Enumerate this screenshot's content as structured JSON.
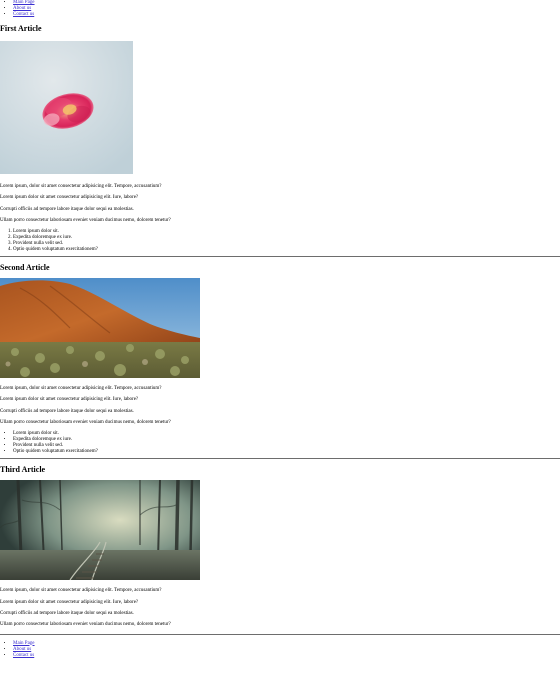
{
  "nav": {
    "items": [
      {
        "label": "Main Page"
      },
      {
        "label": "About us"
      },
      {
        "label": "Contact us"
      }
    ]
  },
  "articles": [
    {
      "title": "First Article",
      "paragraphs": [
        "Lorem ipsum, dolor sit amet consectetur adipisicing elit. Tempore, accusantium?",
        "Lorem ipsum dolor sit amet consectetur adipisicing elit. Iure, labore?",
        "Corrupti officiis ad tempore labore itaque dolor sequi ea molestias.",
        "Ullam porro consectetur laboriosam eveniet veniam ducimus nemo, dolorem tenetur?"
      ],
      "list_type": "ordered",
      "list": [
        "Lorem ipsum dolor sit.",
        "Expedita doloremque ex iure.",
        "Provident nulla velit sed.",
        "Optio quidem voluptatum exercitationem?"
      ]
    },
    {
      "title": "Second Article",
      "paragraphs": [
        "Lorem ipsum, dolor sit amet consectetur adipisicing elit. Tempore, accusantium?",
        "Lorem ipsum dolor sit amet consectetur adipisicing elit. Iure, labore?",
        "Corrupti officiis ad tempore labore itaque dolor sequi ea molestias.",
        "Ullam porro consectetur laboriosam eveniet veniam ducimus nemo, dolorem tenetur?"
      ],
      "list_type": "unordered",
      "list": [
        "Lorem ipsum dolor sit.",
        "Expedita doloremque ex iure.",
        "Provident nulla velit sed.",
        "Optio quidem voluptatum exercitationem?"
      ]
    },
    {
      "title": "Third Article",
      "paragraphs": [
        "Lorem ipsum, dolor sit amet consectetur adipisicing elit. Tempore, accusantium?",
        "Lorem ipsum dolor sit amet consectetur adipisicing elit. Iure, labore?",
        "Corrupti officiis ad tempore labore itaque dolor sequi ea molestias.",
        "Ullam porro consectetur laboriosam eveniet veniam ducimus nemo, dolorem tenetur?"
      ]
    }
  ],
  "footer_nav": {
    "items": [
      {
        "label": "Main Page"
      },
      {
        "label": "About us"
      },
      {
        "label": "Contact us"
      }
    ]
  },
  "colors": {
    "link": "#3b2fd1",
    "divider": "#6d6d6d"
  },
  "images": [
    {
      "icon": "flower-photo"
    },
    {
      "icon": "red-rock-desert-photo"
    },
    {
      "icon": "misty-forest-railway-photo"
    }
  ]
}
